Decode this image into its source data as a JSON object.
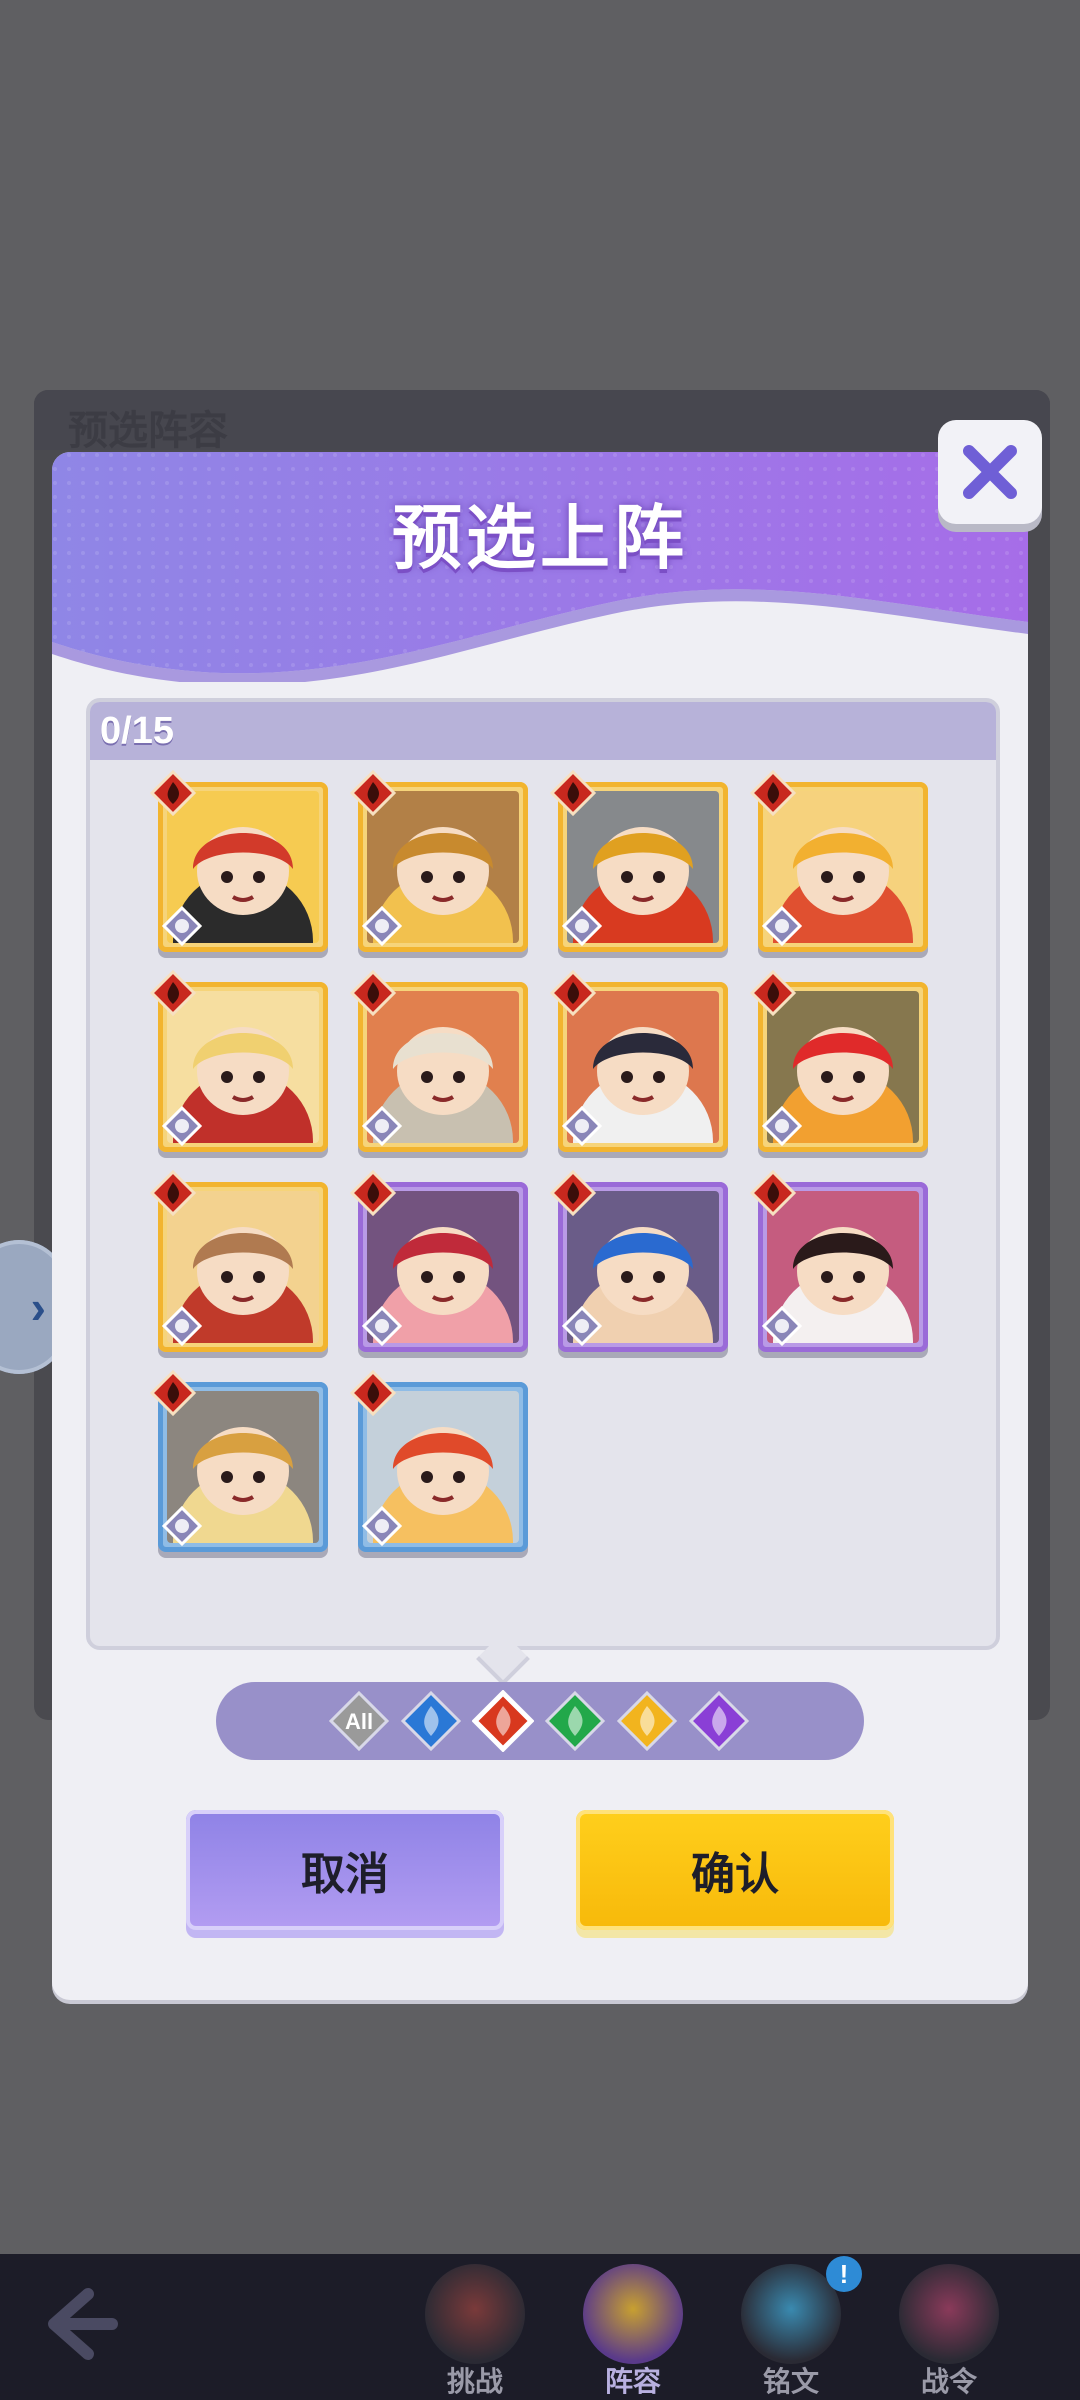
{
  "background": {
    "panel_title": "预选阵容"
  },
  "modal": {
    "title": "预选上阵",
    "count": "0/15",
    "cancel_label": "取消",
    "confirm_label": "确认"
  },
  "filters": [
    {
      "name": "all",
      "label": "All",
      "selected": false,
      "color": "#9a9a9a"
    },
    {
      "name": "water",
      "label": "",
      "selected": false,
      "color": "#2a78d6"
    },
    {
      "name": "fire",
      "label": "",
      "selected": true,
      "color": "#d8381e"
    },
    {
      "name": "wind",
      "label": "",
      "selected": false,
      "color": "#22a84a"
    },
    {
      "name": "light",
      "label": "",
      "selected": false,
      "color": "#f2b41e"
    },
    {
      "name": "dark",
      "label": "",
      "selected": false,
      "color": "#8a3fd6"
    }
  ],
  "heroes": [
    {
      "element": "fire",
      "rarity": "gold",
      "class": "warrior",
      "palette": [
        "#d23a2a",
        "#2b2b2b",
        "#f6c230"
      ]
    },
    {
      "element": "fire",
      "rarity": "gold",
      "class": "ranger",
      "palette": [
        "#c88a2e",
        "#f2c14e",
        "#7a3b1e"
      ]
    },
    {
      "element": "fire",
      "rarity": "gold",
      "class": "mage",
      "palette": [
        "#e0a020",
        "#d83a20",
        "#2a4a9a"
      ]
    },
    {
      "element": "fire",
      "rarity": "gold",
      "class": "warrior",
      "palette": [
        "#f2b030",
        "#e05030",
        "#f6d080"
      ]
    },
    {
      "element": "fire",
      "rarity": "gold",
      "class": "support",
      "palette": [
        "#f0d070",
        "#c0302a",
        "#f6e6c0"
      ]
    },
    {
      "element": "fire",
      "rarity": "gold",
      "class": "tank",
      "palette": [
        "#e8e0d0",
        "#c8c0b0",
        "#d03a2a"
      ]
    },
    {
      "element": "fire",
      "rarity": "gold",
      "class": "assassin",
      "palette": [
        "#2a2a3a",
        "#f0f0f0",
        "#c82a2a"
      ]
    },
    {
      "element": "fire",
      "rarity": "gold",
      "class": "warrior",
      "palette": [
        "#e02a2a",
        "#f2a030",
        "#2a2a2a"
      ]
    },
    {
      "element": "fire",
      "rarity": "gold",
      "class": "tank",
      "palette": [
        "#b07a50",
        "#c03a2a",
        "#f0d0a0"
      ]
    },
    {
      "element": "fire",
      "rarity": "purple",
      "class": "mage",
      "palette": [
        "#c02a3a",
        "#f0a0a8",
        "#3a1a2a"
      ]
    },
    {
      "element": "fire",
      "rarity": "purple",
      "class": "assassin",
      "palette": [
        "#2a6ad0",
        "#f0d0b0",
        "#2a2a3a"
      ]
    },
    {
      "element": "fire",
      "rarity": "purple",
      "class": "ranger",
      "palette": [
        "#2a1a1a",
        "#f4f0f0",
        "#d02a2a"
      ]
    },
    {
      "element": "fire",
      "rarity": "blue",
      "class": "warrior",
      "palette": [
        "#d8a040",
        "#f0d890",
        "#8a5a2a"
      ]
    },
    {
      "element": "fire",
      "rarity": "blue",
      "class": "tank",
      "palette": [
        "#e04a2a",
        "#f6c060",
        "#f0e0d0"
      ]
    }
  ],
  "nav": {
    "tabs": [
      {
        "label": "挑战"
      },
      {
        "label": "阵容"
      },
      {
        "label": "铭文"
      },
      {
        "label": "战令"
      }
    ],
    "alert": "!"
  },
  "colors": {
    "rarity_gold": "#f2b42f",
    "rarity_purple": "#9a6ad8",
    "rarity_blue": "#5a9ad8",
    "modal_header_top": "#b8a3f0",
    "modal_header_bottom": "#8a5fe0"
  }
}
